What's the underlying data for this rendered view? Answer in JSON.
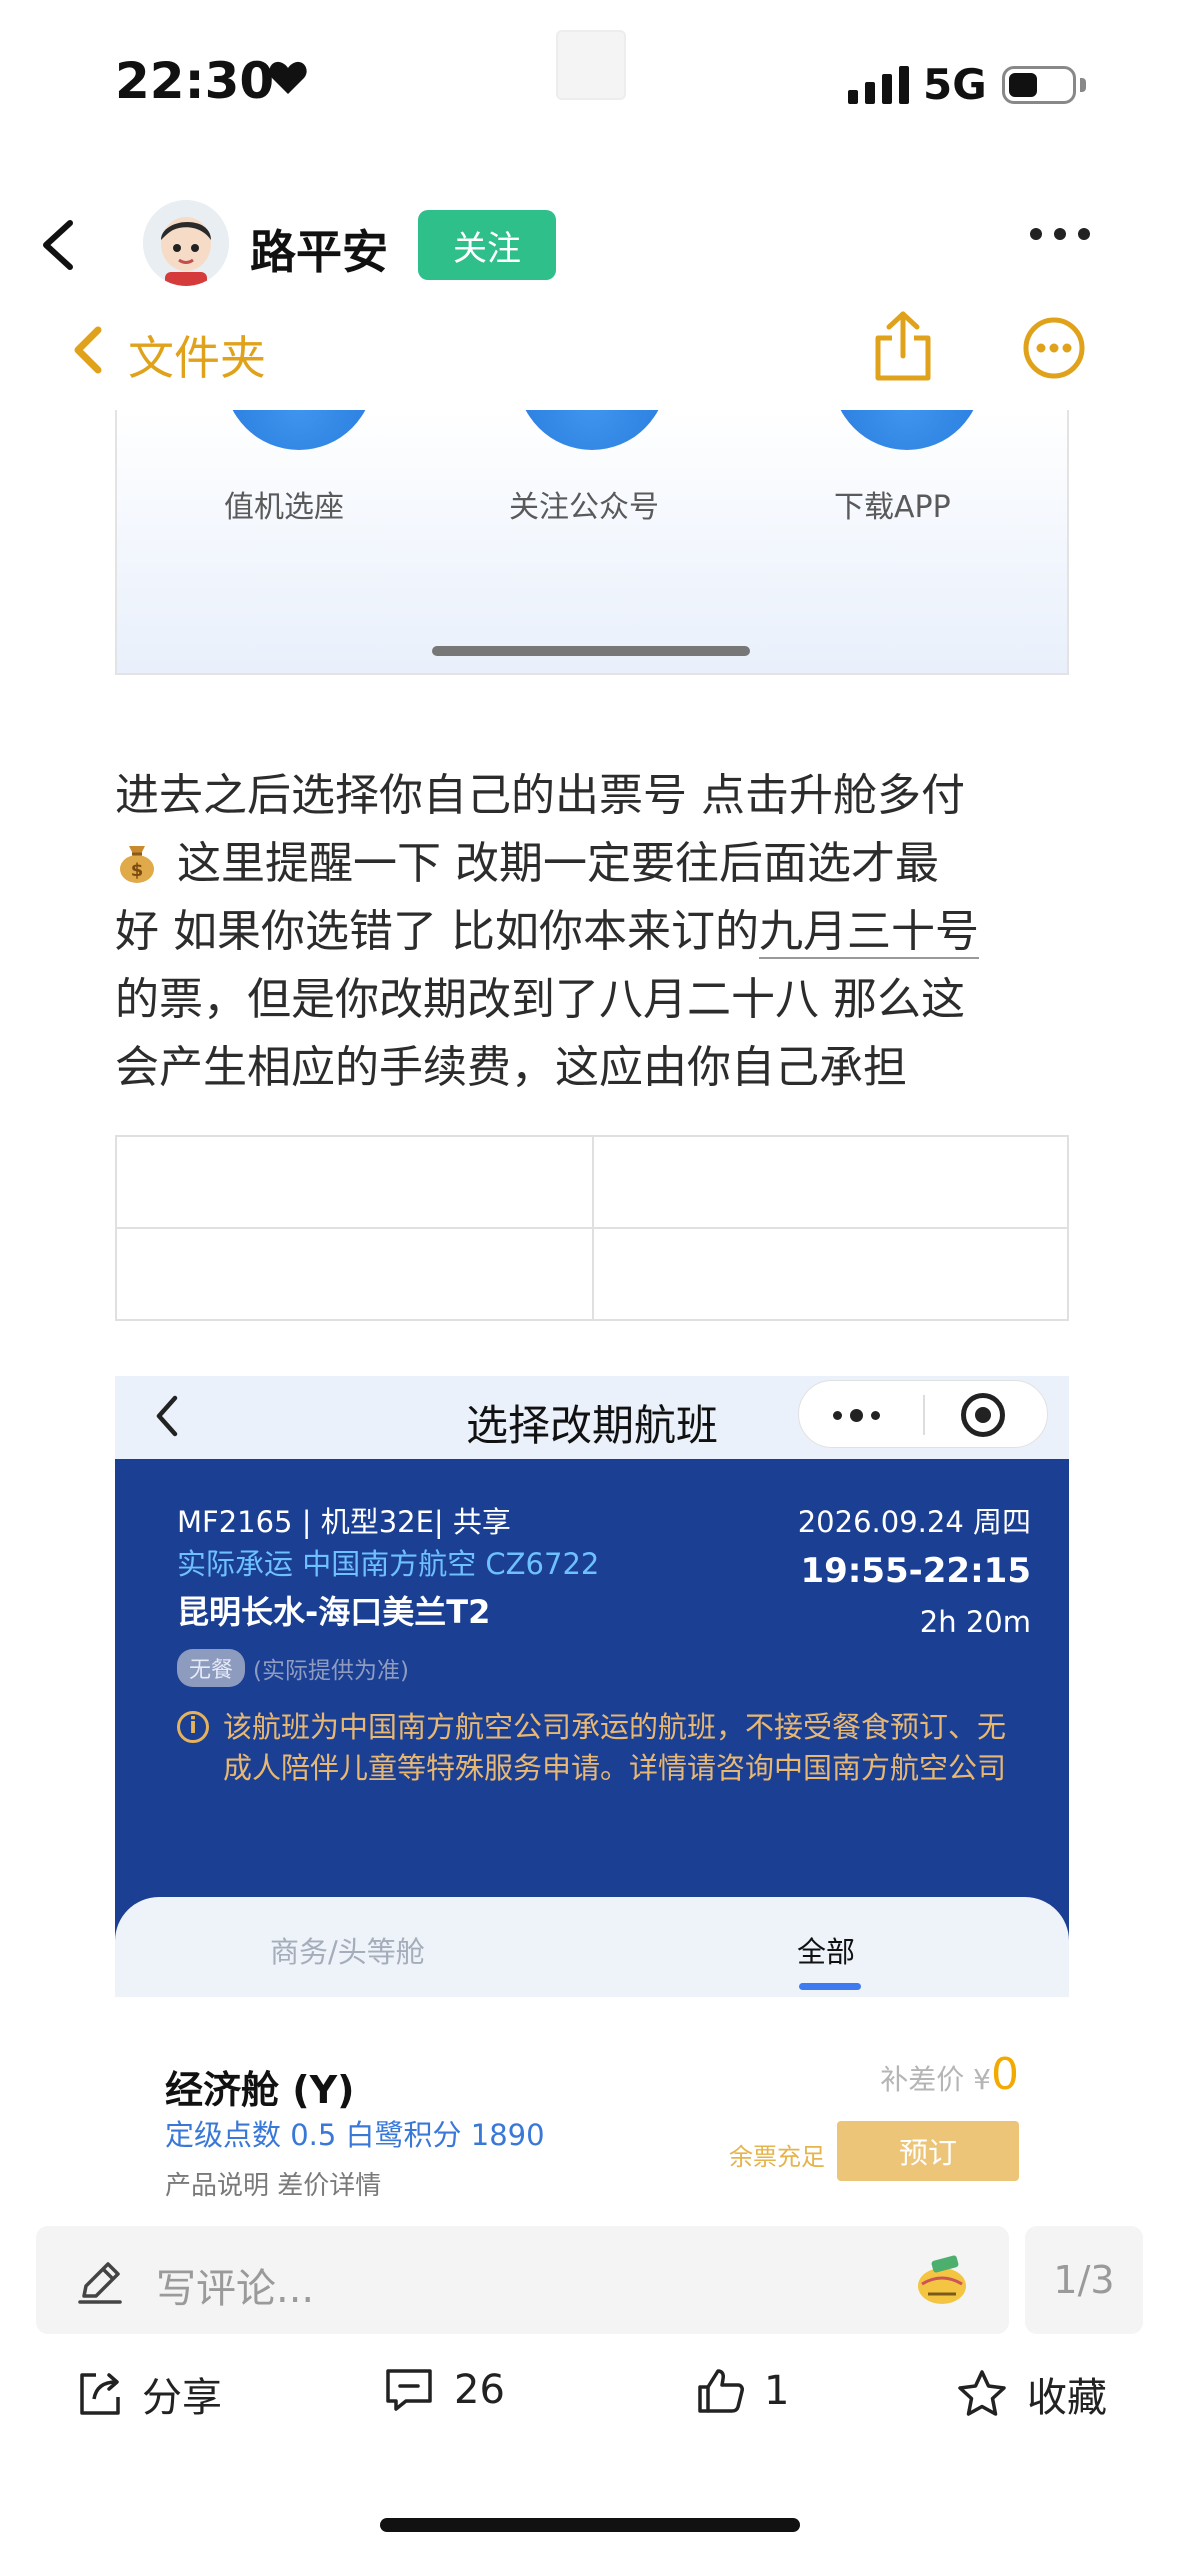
{
  "status_bar": {
    "time": "22:30",
    "network": "5G"
  },
  "header": {
    "author_name": "路平安",
    "follow_label": "关注"
  },
  "folder_bar": {
    "label": "文件夹"
  },
  "top_screenshot": {
    "items": [
      "值机选座",
      "关注公众号",
      "下载APP"
    ]
  },
  "article": {
    "lines": [
      "进去之后选择你自己的出票号  点击升舱多付",
      "这里提醒一下 改期一定要往后面选才最",
      "好 如果你选错了 比如你本来订的",
      "九月三十号",
      "的票，但是你改期改到了八月二十八 那么这",
      "会产生相应的手续费，这应由你自己承担"
    ]
  },
  "flight_screenshot": {
    "title": "选择改期航班",
    "flight_no": "MF2165 | 机型32E| 共享",
    "operator": "实际承运  中国南方航空  CZ6722",
    "route": "昆明长水-海口美兰T2",
    "date": "2026.09.24 周四",
    "time_range": "19:55-22:15",
    "duration": "2h 20m",
    "meal_badge": "无餐",
    "meal_note": "(实际提供为准)",
    "warning": "该航班为中国南方航空公司承运的航班，不接受餐食预订、无成人陪伴儿童等特殊服务申请。详情请咨询中国南方航空公司",
    "tabs": [
      "商务/头等舱",
      "全部"
    ],
    "cabin_name": "经济舱 (Y)",
    "points": "定级点数 0.5   白鹭积分 1890",
    "more_info": "产品说明  差价详情",
    "price_label": "补差价 ¥",
    "price_value": "0",
    "stock_label": "余票充足",
    "book_label": "预订"
  },
  "composer": {
    "placeholder": "写评论...",
    "pager": "1/3"
  },
  "actions": {
    "share_label": "分享",
    "comment_count": "26",
    "like_count": "1",
    "favorite_label": "收藏"
  },
  "colors": {
    "follow_green": "#2fbf8b",
    "folder_yellow": "#e0a21a",
    "flight_blue": "#1b3f93"
  }
}
